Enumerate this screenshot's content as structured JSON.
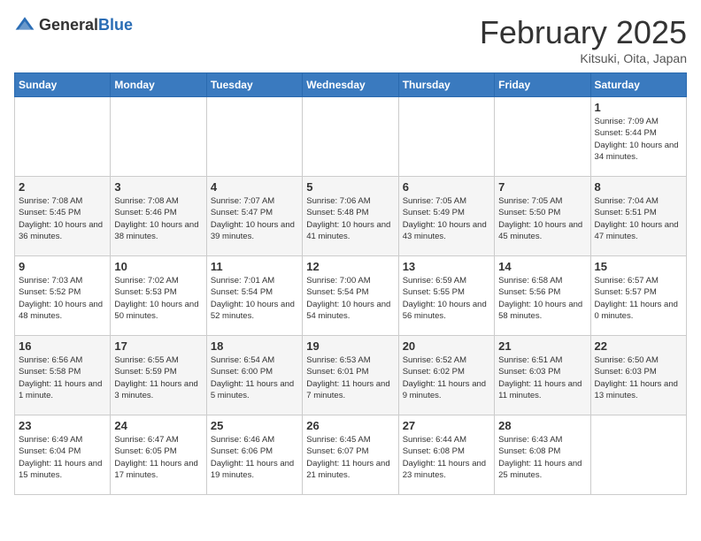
{
  "header": {
    "logo_general": "General",
    "logo_blue": "Blue",
    "title": "February 2025",
    "subtitle": "Kitsuki, Oita, Japan"
  },
  "weekdays": [
    "Sunday",
    "Monday",
    "Tuesday",
    "Wednesday",
    "Thursday",
    "Friday",
    "Saturday"
  ],
  "weeks": [
    [
      {
        "day": "",
        "info": ""
      },
      {
        "day": "",
        "info": ""
      },
      {
        "day": "",
        "info": ""
      },
      {
        "day": "",
        "info": ""
      },
      {
        "day": "",
        "info": ""
      },
      {
        "day": "",
        "info": ""
      },
      {
        "day": "1",
        "info": "Sunrise: 7:09 AM\nSunset: 5:44 PM\nDaylight: 10 hours\nand 34 minutes."
      }
    ],
    [
      {
        "day": "2",
        "info": "Sunrise: 7:08 AM\nSunset: 5:45 PM\nDaylight: 10 hours\nand 36 minutes."
      },
      {
        "day": "3",
        "info": "Sunrise: 7:08 AM\nSunset: 5:46 PM\nDaylight: 10 hours\nand 38 minutes."
      },
      {
        "day": "4",
        "info": "Sunrise: 7:07 AM\nSunset: 5:47 PM\nDaylight: 10 hours\nand 39 minutes."
      },
      {
        "day": "5",
        "info": "Sunrise: 7:06 AM\nSunset: 5:48 PM\nDaylight: 10 hours\nand 41 minutes."
      },
      {
        "day": "6",
        "info": "Sunrise: 7:05 AM\nSunset: 5:49 PM\nDaylight: 10 hours\nand 43 minutes."
      },
      {
        "day": "7",
        "info": "Sunrise: 7:05 AM\nSunset: 5:50 PM\nDaylight: 10 hours\nand 45 minutes."
      },
      {
        "day": "8",
        "info": "Sunrise: 7:04 AM\nSunset: 5:51 PM\nDaylight: 10 hours\nand 47 minutes."
      }
    ],
    [
      {
        "day": "9",
        "info": "Sunrise: 7:03 AM\nSunset: 5:52 PM\nDaylight: 10 hours\nand 48 minutes."
      },
      {
        "day": "10",
        "info": "Sunrise: 7:02 AM\nSunset: 5:53 PM\nDaylight: 10 hours\nand 50 minutes."
      },
      {
        "day": "11",
        "info": "Sunrise: 7:01 AM\nSunset: 5:54 PM\nDaylight: 10 hours\nand 52 minutes."
      },
      {
        "day": "12",
        "info": "Sunrise: 7:00 AM\nSunset: 5:54 PM\nDaylight: 10 hours\nand 54 minutes."
      },
      {
        "day": "13",
        "info": "Sunrise: 6:59 AM\nSunset: 5:55 PM\nDaylight: 10 hours\nand 56 minutes."
      },
      {
        "day": "14",
        "info": "Sunrise: 6:58 AM\nSunset: 5:56 PM\nDaylight: 10 hours\nand 58 minutes."
      },
      {
        "day": "15",
        "info": "Sunrise: 6:57 AM\nSunset: 5:57 PM\nDaylight: 11 hours\nand 0 minutes."
      }
    ],
    [
      {
        "day": "16",
        "info": "Sunrise: 6:56 AM\nSunset: 5:58 PM\nDaylight: 11 hours\nand 1 minute."
      },
      {
        "day": "17",
        "info": "Sunrise: 6:55 AM\nSunset: 5:59 PM\nDaylight: 11 hours\nand 3 minutes."
      },
      {
        "day": "18",
        "info": "Sunrise: 6:54 AM\nSunset: 6:00 PM\nDaylight: 11 hours\nand 5 minutes."
      },
      {
        "day": "19",
        "info": "Sunrise: 6:53 AM\nSunset: 6:01 PM\nDaylight: 11 hours\nand 7 minutes."
      },
      {
        "day": "20",
        "info": "Sunrise: 6:52 AM\nSunset: 6:02 PM\nDaylight: 11 hours\nand 9 minutes."
      },
      {
        "day": "21",
        "info": "Sunrise: 6:51 AM\nSunset: 6:03 PM\nDaylight: 11 hours\nand 11 minutes."
      },
      {
        "day": "22",
        "info": "Sunrise: 6:50 AM\nSunset: 6:03 PM\nDaylight: 11 hours\nand 13 minutes."
      }
    ],
    [
      {
        "day": "23",
        "info": "Sunrise: 6:49 AM\nSunset: 6:04 PM\nDaylight: 11 hours\nand 15 minutes."
      },
      {
        "day": "24",
        "info": "Sunrise: 6:47 AM\nSunset: 6:05 PM\nDaylight: 11 hours\nand 17 minutes."
      },
      {
        "day": "25",
        "info": "Sunrise: 6:46 AM\nSunset: 6:06 PM\nDaylight: 11 hours\nand 19 minutes."
      },
      {
        "day": "26",
        "info": "Sunrise: 6:45 AM\nSunset: 6:07 PM\nDaylight: 11 hours\nand 21 minutes."
      },
      {
        "day": "27",
        "info": "Sunrise: 6:44 AM\nSunset: 6:08 PM\nDaylight: 11 hours\nand 23 minutes."
      },
      {
        "day": "28",
        "info": "Sunrise: 6:43 AM\nSunset: 6:08 PM\nDaylight: 11 hours\nand 25 minutes."
      },
      {
        "day": "",
        "info": ""
      }
    ]
  ]
}
